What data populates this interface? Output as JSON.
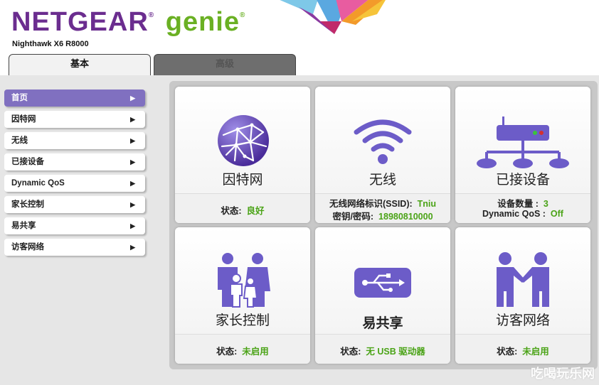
{
  "header": {
    "brand": "NETGEAR",
    "brand_suffix": "genie",
    "model": "Nighthawk X6 R8000"
  },
  "tabs": [
    {
      "label": "基本",
      "active": true
    },
    {
      "label": "高级",
      "active": false
    }
  ],
  "sidebar": {
    "items": [
      {
        "label": "首页",
        "active": true
      },
      {
        "label": "因特网"
      },
      {
        "label": "无线"
      },
      {
        "label": "已接设备"
      },
      {
        "label": "Dynamic QoS"
      },
      {
        "label": "家长控制"
      },
      {
        "label": "易共享"
      },
      {
        "label": "访客网络"
      }
    ],
    "arrow": "▶"
  },
  "cards": {
    "internet": {
      "title": "因特网",
      "status_label": "状态:",
      "status_value": "良好",
      "icon": "globe-icon"
    },
    "wireless": {
      "title": "无线",
      "ssid_label": "无线网络标识(SSID):",
      "ssid_value": "Tniu",
      "key_label": "密钥/密码:",
      "key_value": "18980810000",
      "icon": "wifi-icon"
    },
    "devices": {
      "title": "已接设备",
      "count_label": "设备数量 :",
      "count_value": "3",
      "qos_label": "Dynamic QoS :",
      "qos_value": "Off",
      "icon": "router-network-icon"
    },
    "parental": {
      "title": "家长控制",
      "status_label": "状态:",
      "status_value": "未启用",
      "icon": "family-icon"
    },
    "readyshare": {
      "title": "易共享",
      "status_label": "状态:",
      "status_value": "无 USB 驱动器",
      "icon": "usb-icon"
    },
    "guest": {
      "title": "访客网络",
      "status_label": "状态:",
      "status_value": "未启用",
      "icon": "handshake-icon"
    }
  },
  "watermark": "吃喝玩乐网",
  "colors": {
    "brand_purple": "#6b2d8f",
    "brand_green": "#6ab023",
    "status_green": "#4aa316",
    "sidebar_active": "#8070c0",
    "icon_purple": "#6c5cc8"
  }
}
